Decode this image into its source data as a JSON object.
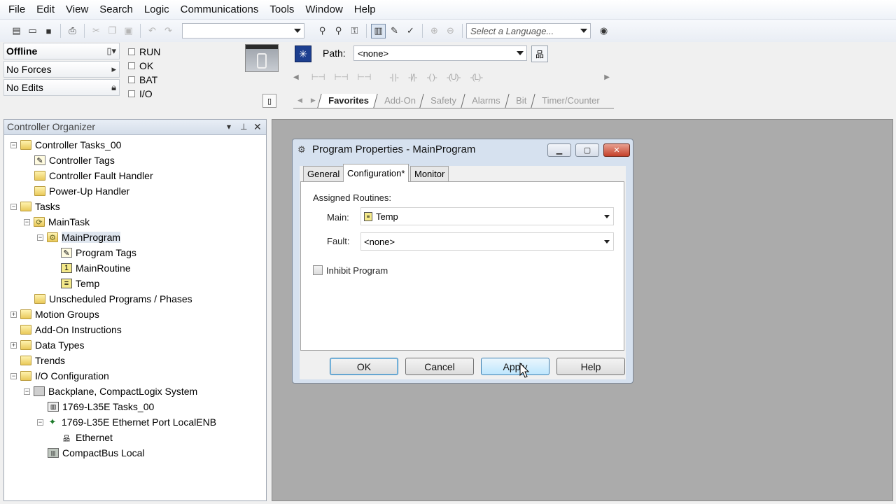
{
  "menu": [
    "File",
    "Edit",
    "View",
    "Search",
    "Logic",
    "Communications",
    "Tools",
    "Window",
    "Help"
  ],
  "toolbar": {
    "language_placeholder": "Select a Language...",
    "search_value": ""
  },
  "status": {
    "mode": "Offline",
    "forces": "No Forces",
    "edits": "No Edits",
    "leds": [
      "RUN",
      "OK",
      "BAT",
      "I/O"
    ]
  },
  "path": {
    "label": "Path:",
    "value": "<none>"
  },
  "instruction_tabs": [
    "Favorites",
    "Add-On",
    "Safety",
    "Alarms",
    "Bit",
    "Timer/Counter"
  ],
  "organizer": {
    "title": "Controller Organizer",
    "tree": [
      {
        "label": "Controller Tasks_00",
        "icon": "folder-open-icon"
      },
      {
        "label": "Controller Tags",
        "icon": "tags-icon"
      },
      {
        "label": "Controller Fault Handler",
        "icon": "folder-icon"
      },
      {
        "label": "Power-Up Handler",
        "icon": "folder-icon"
      },
      {
        "label": "Tasks",
        "icon": "folder-open-icon"
      },
      {
        "label": "MainTask",
        "icon": "task-icon"
      },
      {
        "label": "MainProgram",
        "icon": "program-icon"
      },
      {
        "label": "Program Tags",
        "icon": "tags-icon"
      },
      {
        "label": "MainRoutine",
        "icon": "routine-icon"
      },
      {
        "label": "Temp",
        "icon": "routine-icon"
      },
      {
        "label": "Unscheduled Programs / Phases",
        "icon": "folder-icon"
      },
      {
        "label": "Motion Groups",
        "icon": "folder-icon"
      },
      {
        "label": "Add-On Instructions",
        "icon": "folder-icon"
      },
      {
        "label": "Data Types",
        "icon": "folder-icon"
      },
      {
        "label": "Trends",
        "icon": "folder-icon"
      },
      {
        "label": "I/O Configuration",
        "icon": "folder-open-icon"
      },
      {
        "label": "Backplane, CompactLogix System",
        "icon": "backplane-icon"
      },
      {
        "label": "1769-L35E Tasks_00",
        "icon": "controller-icon"
      },
      {
        "label": "1769-L35E Ethernet Port LocalENB",
        "icon": "ethernet-port-icon"
      },
      {
        "label": "Ethernet",
        "icon": "network-icon"
      },
      {
        "label": "CompactBus Local",
        "icon": "bus-icon"
      }
    ]
  },
  "dialog": {
    "title": "Program Properties - MainProgram",
    "tabs": [
      "General",
      "Configuration*",
      "Monitor"
    ],
    "assigned_routines_label": "Assigned Routines:",
    "main_label": "Main:",
    "main_value": "Temp",
    "fault_label": "Fault:",
    "fault_value": "<none>",
    "inhibit_label": "Inhibit Program",
    "buttons": {
      "ok": "OK",
      "cancel": "Cancel",
      "apply": "Apply",
      "help": "Help"
    }
  }
}
